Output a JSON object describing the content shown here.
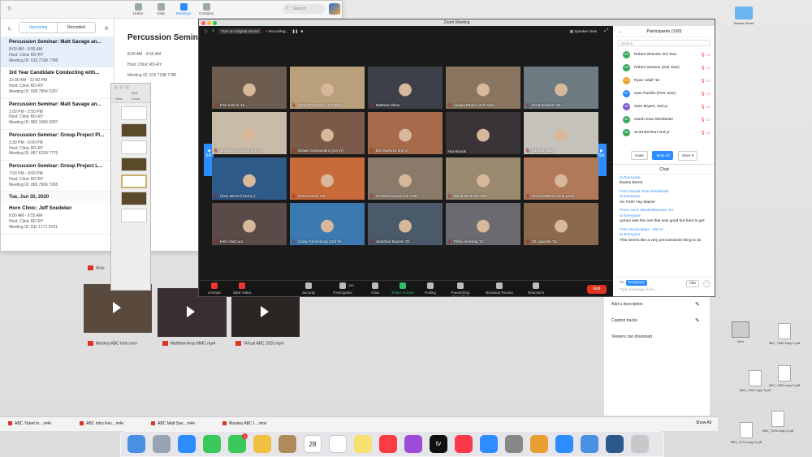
{
  "desktop": {
    "icons": [
      {
        "name": "Shared Drives",
        "kind": "folder"
      },
      {
        "name": "Intro",
        "kind": "disk"
      },
      {
        "name": "IMG_7482 copy 2.pdf",
        "kind": "file"
      },
      {
        "name": "IMG_7481 copy 3.pdf",
        "kind": "file"
      },
      {
        "name": "IMG_7480 copy 5.pdf",
        "kind": "file"
      },
      {
        "name": "IMG_7479 copy 4.pdf",
        "kind": "file"
      },
      {
        "name": "IMG_7478 copy 2.pdf",
        "kind": "file"
      },
      {
        "name": "IMG_7477 copy 2.pdf",
        "kind": "file"
      },
      {
        "name": "IMG_7476.pdf",
        "kind": "file"
      }
    ]
  },
  "zoom_main": {
    "nav": [
      {
        "label": "Home",
        "icon": "home-icon"
      },
      {
        "label": "Chat",
        "icon": "chat-icon"
      },
      {
        "label": "Meetings",
        "icon": "clock-icon"
      },
      {
        "label": "Contacts",
        "icon": "contacts-icon"
      }
    ],
    "search_placeholder": "Search",
    "tabs": {
      "upcoming": "Upcoming",
      "recorded": "Recorded"
    },
    "meetings": [
      {
        "title": "Percussion Seminar: Matt Savage an...",
        "time": "8:00 AM - 9:55 AM",
        "host": "Host: Clinic RD-RY",
        "id": "Meeting ID: 615 7198 7786",
        "selected": true
      },
      {
        "title": "3rd Year Candidate Conducting with...",
        "time": "10:30 AM - 12:00 PM",
        "host": "Host: Clinic RD-RY",
        "id": "Meeting ID: 838 7854 5207",
        "selected": false
      },
      {
        "title": "Percussion Seminar: Matt Savage an...",
        "time": "1:00 PM - 2:50 PM",
        "host": "Host: Clinic RD-RY",
        "id": "Meeting ID: 865 1669 9287",
        "selected": false
      },
      {
        "title": "Percussion Seminar: Group Project Pl...",
        "time": "3:30 PM - 6:00 PM",
        "host": "Host: Clinic RD-RY",
        "id": "Meeting ID: 867 6159 7775",
        "selected": false
      },
      {
        "title": "Percussion Seminar: Group Project L...",
        "time": "7:00 PM - 9:00 PM",
        "host": "Host: Clinic RD-RY",
        "id": "Meeting ID: 865 7506 7265",
        "selected": false
      }
    ],
    "day_header": "Tue, Jun 30, 2020",
    "next_meeting": {
      "title": "Horn Clinic: Jeff Snedeker",
      "time": "8:00 AM - 9:55 AM",
      "host": "Host: Clinic RD-RY",
      "id": "Meeting ID: 811 1771 5761"
    },
    "detail": {
      "title": "Percussion Seminar",
      "time": "8:00 AM - 9:55 AM",
      "host": "Host: Clinic RD-RY",
      "id": "Meeting ID: 615 7198 7786"
    }
  },
  "keynote": {
    "view_label": "View",
    "zoom_label": "Zoom",
    "zoom_value": "54%",
    "add_slide": "Add Slide"
  },
  "files": [
    {
      "name": "Mackey ABC Intro.mov"
    },
    {
      "name": "Matthew Arau MMC.mp4"
    },
    {
      "name": "Virtual ABC 2020.mp4"
    },
    {
      "name": "Arau"
    }
  ],
  "meeting": {
    "window_title": "Zoom Meeting",
    "original_sound": "Turn on Original Sound",
    "recording": "Recording...",
    "speaker_view": "Speaker View",
    "page_left": "6/6",
    "page_right": "6/6",
    "tiles": [
      {
        "name": "Ellie Kohick '15",
        "muted": true,
        "color": "#6b5c4f"
      },
      {
        "name": "Cathy Thompson (1st Year)",
        "muted": true,
        "color": "#b9a07a"
      },
      {
        "name": "Matthew Skiba",
        "muted": true,
        "color": "#3d4048"
      },
      {
        "name": "Angela Panno (2nd Year)",
        "muted": true,
        "color": "#8a7560"
      },
      {
        "name": "Scott Schwarz '15",
        "muted": true,
        "color": "#6d7a82"
      },
      {
        "name": "Monica Overstreet (2nd Ye...",
        "muted": true,
        "color": "#c8bca8"
      },
      {
        "name": "Shawn Campopiano (1st Yr)",
        "muted": true,
        "color": "#7b5a4a"
      },
      {
        "name": "Eric Ramirez 2nd yr",
        "muted": true,
        "color": "#a56b4a"
      },
      {
        "name": "Ana Woods",
        "muted": false,
        "color": "#3a3438"
      },
      {
        "name": "Edward Maag",
        "muted": true,
        "color": "#c5c2bc"
      },
      {
        "name": "Chris Mitchell (3rd yr.)",
        "muted": true,
        "color": "#2e5a8a"
      },
      {
        "name": "Fiona Karbel 3rd",
        "muted": true,
        "color": "#c96a3a"
      },
      {
        "name": "Christina Bryant (1st Year)",
        "muted": true,
        "color": "#8a7a6a"
      },
      {
        "name": "David Munk 1st Year",
        "muted": true,
        "color": "#9a8a70"
      },
      {
        "name": "Jenna DiMento (2nd year)",
        "muted": true,
        "color": "#b07a5a"
      },
      {
        "name": "Kelsi VanCura",
        "muted": true,
        "color": "#5a4a48"
      },
      {
        "name": "Corey Tumondong (2nd Ye...",
        "muted": true,
        "color": "#3a7ab0"
      },
      {
        "name": "Jonathan Boysen '02",
        "muted": true,
        "color": "#4a5a6a"
      },
      {
        "name": "Phillip Hoesing '22",
        "muted": true,
        "color": "#6a6a70"
      },
      {
        "name": "Gil Lapointe '04",
        "muted": true,
        "color": "#8a6a4a"
      }
    ],
    "toolbar": [
      {
        "label": "Unmute",
        "icon": "mic-icon"
      },
      {
        "label": "Start Video",
        "icon": "video-icon"
      },
      {
        "label": "Security",
        "icon": "shield-icon"
      },
      {
        "label": "Participants",
        "icon": "participants-icon",
        "count": "160"
      },
      {
        "label": "Chat",
        "icon": "chat-icon"
      },
      {
        "label": "Share Screen",
        "icon": "share-screen-icon"
      },
      {
        "label": "Polling",
        "icon": "polling-icon"
      },
      {
        "label": "Pause/Stop Recording",
        "icon": "record-icon"
      },
      {
        "label": "Breakout Rooms",
        "icon": "breakout-icon"
      },
      {
        "label": "Reactions",
        "icon": "reactions-icon"
      }
    ],
    "end_label": "End",
    "participants": {
      "title": "Participants (160)",
      "search_placeholder": "Search",
      "list": [
        {
          "initials": "RS",
          "name": "Robert Sherwin 3rd Year",
          "color": "#3aa85a"
        },
        {
          "initials": "RS",
          "name": "Robert Stearns (2nd Year)",
          "color": "#3aa85a"
        },
        {
          "initials": "RJ",
          "name": "Ryan Udall '15",
          "color": "#e8a030"
        },
        {
          "initials": "SP",
          "name": "Sam Parrilla (First Year)",
          "color": "#2d8cff"
        },
        {
          "initials": "SB",
          "name": "Sara Bryant, 2nd yr",
          "color": "#7a5acf"
        },
        {
          "initials": "SD",
          "name": "Sarah Dow-Shedlarski",
          "color": "#3aa85a"
        },
        {
          "initials": "SB",
          "name": "Scott Benhart 2nd yr",
          "color": "#3aa85a"
        }
      ],
      "buttons": {
        "invite": "Invite",
        "mute_all": "Mute All",
        "more": "More"
      }
    },
    "chat": {
      "title": "Chat",
      "messages": [
        {
          "from": "",
          "to": "to Everyone",
          "text": "thanks Brent!"
        },
        {
          "from": "From Sarah Dow-Shedlarski",
          "to": "to Everyone",
          "text": "Vic Firth!  Yay Maine!"
        },
        {
          "from": "From Anne Vanderbloemen '13",
          "to": "to Everyone",
          "text": "xymox was the one that was good but hard to get"
        },
        {
          "from": "From Kevin Bays - 3rd Yr",
          "to": "to Everyone",
          "text": "This seems like a very percussionist thing to do"
        }
      ],
      "to_label": "To:",
      "to_value": "Everyone",
      "file_label": "File",
      "placeholder": "Type message here..."
    }
  },
  "right_panel": {
    "add_description": "Add a description",
    "caption_tracks": "Caption tracks",
    "viewers": "Viewers can download"
  },
  "downloads": {
    "items": [
      "ABC Ticket In....m4v",
      "ABC Intro Kev....m4v",
      "ABC Matt Sav....m4v",
      "Mackey ABC I....mov"
    ],
    "show_all": "Show All"
  },
  "dock": {
    "apps": [
      {
        "name": "finder-icon",
        "color": "#4a90e2"
      },
      {
        "name": "launchpad-icon",
        "color": "#9aa3b5"
      },
      {
        "name": "safari-icon",
        "color": "#2d8cff"
      },
      {
        "name": "messages-icon",
        "color": "#3ac85a",
        "badge": ""
      },
      {
        "name": "facetime-icon",
        "color": "#3ac85a",
        "badge": "8"
      },
      {
        "name": "photos-icon",
        "color": "#f0c040"
      },
      {
        "name": "contacts-icon",
        "color": "#b08a5a"
      },
      {
        "name": "calendar-icon",
        "color": "#ffffff",
        "text": "28"
      },
      {
        "name": "reminders-icon",
        "color": "#ffffff"
      },
      {
        "name": "notes-icon",
        "color": "#f8e070"
      },
      {
        "name": "music-icon",
        "color": "#fc3c44"
      },
      {
        "name": "podcasts-icon",
        "color": "#9b4bd8"
      },
      {
        "name": "tv-icon",
        "color": "#111111",
        "text": "tv"
      },
      {
        "name": "news-icon",
        "color": "#fa3a4a"
      },
      {
        "name": "appstore-icon",
        "color": "#2d8cff"
      },
      {
        "name": "preferences-icon",
        "color": "#888888"
      },
      {
        "name": "chrome-icon",
        "color": "#e8a030"
      },
      {
        "name": "zoom-icon",
        "color": "#2d8cff"
      },
      {
        "name": "keynote-icon",
        "color": "#4a90e2"
      },
      {
        "name": "quicktime-icon",
        "color": "#2a5a8a"
      },
      {
        "name": "trash-icon",
        "color": "#c8c8c8"
      }
    ],
    "calendar_badge": "28"
  }
}
